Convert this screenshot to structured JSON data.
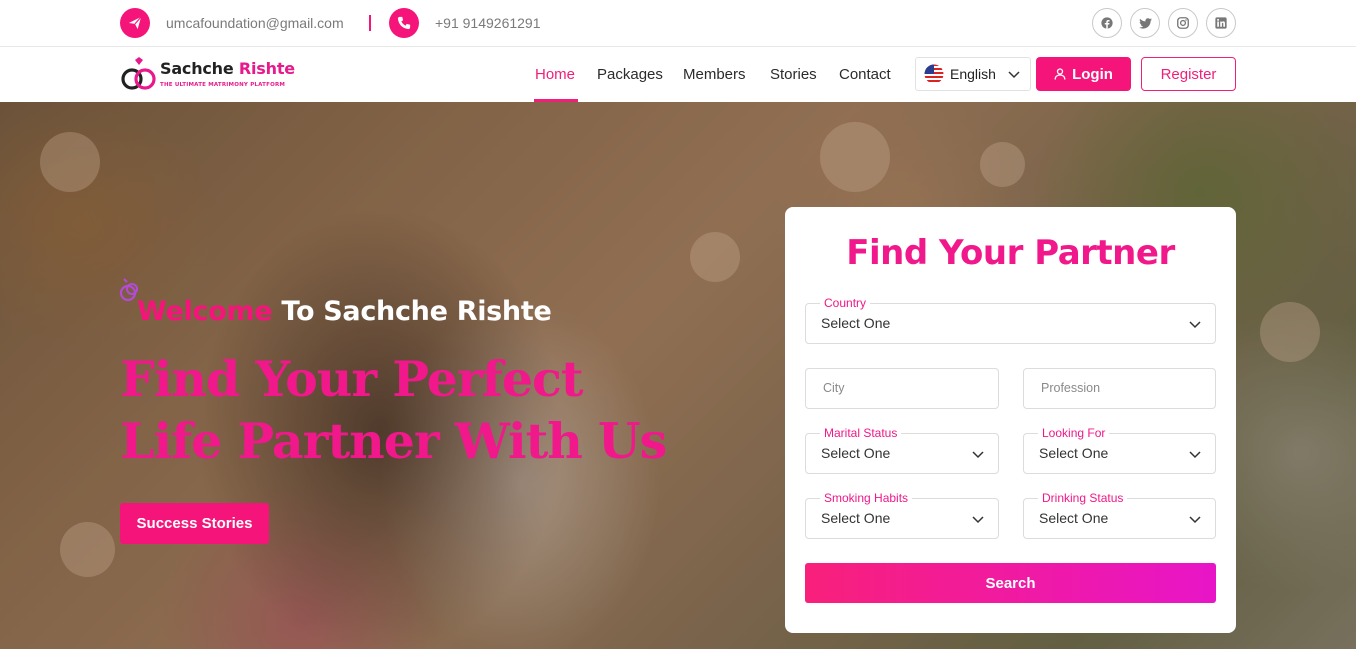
{
  "topbar": {
    "email": "umcafoundation@gmail.com",
    "phone": "+91 9149261291",
    "social_icons": [
      "facebook-icon",
      "twitter-icon",
      "instagram-icon",
      "linkedin-icon"
    ]
  },
  "brand": {
    "name_part1": "Sachche",
    "name_part2": "Rishte",
    "tagline": "THE ULTIMATE MATRIMONY PLATFORM"
  },
  "nav": {
    "items": [
      {
        "label": "Home",
        "active": true
      },
      {
        "label": "Packages",
        "active": false
      },
      {
        "label": "Members",
        "active": false
      },
      {
        "label": "Stories",
        "active": false
      },
      {
        "label": "Contact",
        "active": false
      }
    ],
    "language": "English",
    "login_label": "Login",
    "register_label": "Register"
  },
  "hero": {
    "welcome_pink": "Welcome",
    "welcome_rest": "To Sachche Rishte",
    "headline": "Find Your Perfect Life Partner With Us",
    "button_label": "Success Stories"
  },
  "search": {
    "title": "Find Your Partner",
    "country": {
      "label": "Country",
      "value": "Select One"
    },
    "city": {
      "placeholder": "City"
    },
    "profession": {
      "placeholder": "Profession"
    },
    "marital_status": {
      "label": "Marital Status",
      "value": "Select One"
    },
    "looking_for": {
      "label": "Looking For",
      "value": "Select One"
    },
    "smoking_habits": {
      "label": "Smoking Habits",
      "value": "Select One"
    },
    "drinking_status": {
      "label": "Drinking Status",
      "value": "Select One"
    },
    "button_label": "Search"
  },
  "colors": {
    "brand_pink": "#f5157a",
    "gradient_end": "#e815c8"
  }
}
